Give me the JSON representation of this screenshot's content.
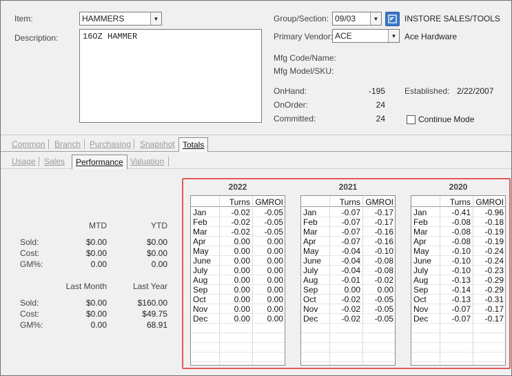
{
  "item": {
    "item_label": "Item:",
    "item_value": "HAMMERS",
    "description_label": "Description:",
    "description_value": "16OZ HAMMER",
    "group_label": "Group/Section:",
    "group_value": "09/03",
    "group_name": "INSTORE SALES/TOOLS",
    "vendor_label": "Primary Vendor:",
    "vendor_value": "ACE",
    "vendor_name": "Ace Hardware",
    "mfg_code_label": "Mfg Code/Name:",
    "mfg_model_label": "Mfg Model/SKU:",
    "onhand_label": "OnHand:",
    "onhand_value": "-195",
    "onorder_label": "OnOrder:",
    "onorder_value": "24",
    "committed_label": "Committed:",
    "committed_value": "24",
    "established_label": "Established:",
    "established_value": "2/22/2007",
    "continue_mode_label": "Continue Mode"
  },
  "main_tabs": [
    {
      "label": "Common"
    },
    {
      "label": "Branch"
    },
    {
      "label": "Purchasing"
    },
    {
      "label": "Snapshot"
    },
    {
      "label": "Totals"
    }
  ],
  "sub_tabs": [
    {
      "label": "Usage"
    },
    {
      "label": "Sales"
    },
    {
      "label": "Performance"
    },
    {
      "label": "Valuation"
    }
  ],
  "summary": {
    "mtd_header": "MTD",
    "ytd_header": "YTD",
    "last_month_header": "Last Month",
    "last_year_header": "Last Year",
    "sold_label": "Sold:",
    "cost_label": "Cost:",
    "gm_label": "GM%:",
    "current": {
      "sold_mtd": "$0.00",
      "sold_ytd": "$0.00",
      "cost_mtd": "$0.00",
      "cost_ytd": "$0.00",
      "gm_mtd": "0.00",
      "gm_ytd": "0.00"
    },
    "previous": {
      "sold_lm": "$0.00",
      "sold_ly": "$160.00",
      "cost_lm": "$0.00",
      "cost_ly": "$49.75",
      "gm_lm": "0.00",
      "gm_ly": "68.91"
    }
  },
  "performance": {
    "col_turns": "Turns",
    "col_gmroi": "GMROI",
    "years": [
      {
        "year": "2022",
        "rows": [
          {
            "month": "Jan",
            "turns": "-0.02",
            "gmroi": "-0.05"
          },
          {
            "month": "Feb",
            "turns": "-0.02",
            "gmroi": "-0.05"
          },
          {
            "month": "Mar",
            "turns": "-0.02",
            "gmroi": "-0.05"
          },
          {
            "month": "Apr",
            "turns": "0.00",
            "gmroi": "0.00"
          },
          {
            "month": "May",
            "turns": "0.00",
            "gmroi": "0.00"
          },
          {
            "month": "June",
            "turns": "0.00",
            "gmroi": "0.00"
          },
          {
            "month": "July",
            "turns": "0.00",
            "gmroi": "0.00"
          },
          {
            "month": "Aug",
            "turns": "0.00",
            "gmroi": "0.00"
          },
          {
            "month": "Sep",
            "turns": "0.00",
            "gmroi": "0.00"
          },
          {
            "month": "Oct",
            "turns": "0.00",
            "gmroi": "0.00"
          },
          {
            "month": "Nov",
            "turns": "0.00",
            "gmroi": "0.00"
          },
          {
            "month": "Dec",
            "turns": "0.00",
            "gmroi": "0.00"
          }
        ]
      },
      {
        "year": "2021",
        "rows": [
          {
            "month": "Jan",
            "turns": "-0.07",
            "gmroi": "-0.17"
          },
          {
            "month": "Feb",
            "turns": "-0.07",
            "gmroi": "-0.17"
          },
          {
            "month": "Mar",
            "turns": "-0.07",
            "gmroi": "-0.16"
          },
          {
            "month": "Apr",
            "turns": "-0.07",
            "gmroi": "-0.16"
          },
          {
            "month": "May",
            "turns": "-0.04",
            "gmroi": "-0.10"
          },
          {
            "month": "June",
            "turns": "-0.04",
            "gmroi": "-0.08"
          },
          {
            "month": "July",
            "turns": "-0.04",
            "gmroi": "-0.08"
          },
          {
            "month": "Aug",
            "turns": "-0.01",
            "gmroi": "-0.02"
          },
          {
            "month": "Sep",
            "turns": "0.00",
            "gmroi": "0.00"
          },
          {
            "month": "Oct",
            "turns": "-0.02",
            "gmroi": "-0.05"
          },
          {
            "month": "Nov",
            "turns": "-0.02",
            "gmroi": "-0.05"
          },
          {
            "month": "Dec",
            "turns": "-0.02",
            "gmroi": "-0.05"
          }
        ]
      },
      {
        "year": "2020",
        "rows": [
          {
            "month": "Jan",
            "turns": "-0.41",
            "gmroi": "-0.96"
          },
          {
            "month": "Feb",
            "turns": "-0.08",
            "gmroi": "-0.18"
          },
          {
            "month": "Mar",
            "turns": "-0.08",
            "gmroi": "-0.19"
          },
          {
            "month": "Apr",
            "turns": "-0.08",
            "gmroi": "-0.19"
          },
          {
            "month": "May",
            "turns": "-0.10",
            "gmroi": "-0.24"
          },
          {
            "month": "June",
            "turns": "-0.10",
            "gmroi": "-0.24"
          },
          {
            "month": "July",
            "turns": "-0.10",
            "gmroi": "-0.23"
          },
          {
            "month": "Aug",
            "turns": "-0.13",
            "gmroi": "-0.29"
          },
          {
            "month": "Sep",
            "turns": "-0.14",
            "gmroi": "-0.29"
          },
          {
            "month": "Oct",
            "turns": "-0.13",
            "gmroi": "-0.31"
          },
          {
            "month": "Nov",
            "turns": "-0.07",
            "gmroi": "-0.17"
          },
          {
            "month": "Dec",
            "turns": "-0.07",
            "gmroi": "-0.17"
          }
        ]
      }
    ]
  },
  "colors": {
    "highlight": "#e05a5a",
    "nav_button": "#3b78c5"
  }
}
